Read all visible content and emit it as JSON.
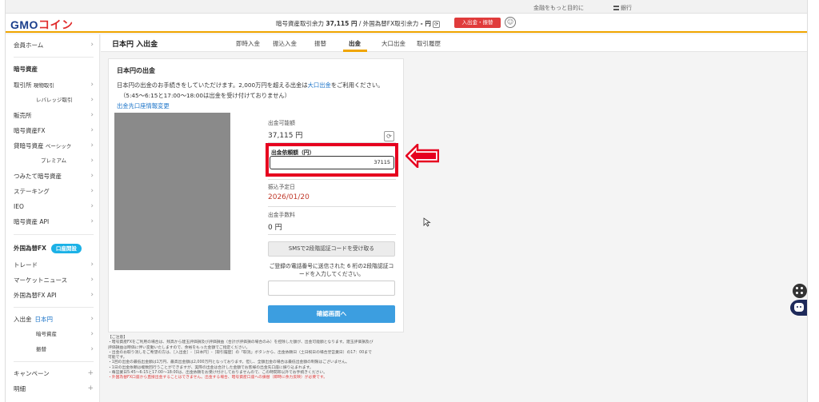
{
  "utility": {
    "more_convenient": "金融をもっと目的に",
    "bank": "銀行"
  },
  "header": {
    "logo_main": "GMO",
    "logo_sub": "コイン",
    "crypto_available_label": "暗号資産取引余力",
    "crypto_available_value": "37,115 円",
    "separator": "/",
    "fx_available_label": "外国為替FX取引余力",
    "fx_available_value": "- 円",
    "deposit_button": "入出金・振替"
  },
  "sidebar": {
    "home": "会員ホーム",
    "crypto_heading": "暗号資産",
    "exchange": "取引所",
    "exchange_sub": "現物取引",
    "leverage": "レバレッジ取引",
    "dealer": "販売所",
    "crypto_fx": "暗号資産FX",
    "lending": "貸暗号資産",
    "lending_sub": "ベーシック",
    "premium": "プレミアム",
    "tsumitate": "つみたて暗号資産",
    "staking": "ステーキング",
    "ieo": "IEO",
    "crypto_api": "暗号資産 API",
    "fx_heading": "外国為替FX",
    "fx_badge": "口座開設",
    "trade": "トレード",
    "market_news": "マーケットニュース",
    "fx_api": "外国為替FX API",
    "deposit_withdraw": "入出金",
    "jpy": "日本円",
    "crypto_assets": "暗号資産",
    "transfer": "振替",
    "campaign": "キャンペーン",
    "details": "明細",
    "chev": "›",
    "plus": "+"
  },
  "tabs": {
    "page_title": "日本円 入出金",
    "items": [
      "即時入金",
      "振込入金",
      "振替",
      "出金",
      "大口出金",
      "取引履歴"
    ]
  },
  "card": {
    "title": "日本円の出金",
    "intro_part1": "日本円の出金のお手続きをしていただけます。2,000万円を超える出金は",
    "intro_link": "大口出金",
    "intro_part2": "をご利用ください。",
    "intro_hours": "（5:45〜6:15と17:00〜18:00は出金を受け付けておりません）",
    "bank_change_link": "出金先口座情報変更"
  },
  "form": {
    "available_label": "出金可能額",
    "available_value": "37,115 円",
    "amount_label": "出金依頼額（円）",
    "amount_value": "37115",
    "transfer_date_label": "振込予定日",
    "transfer_date_value": "2026/01/20",
    "fee_label": "出金手数料",
    "fee_value": "0 円",
    "sms_button": "SMSで2段階認証コードを受け取る",
    "sms_note": "ご登録の電話番号に送信された 6 桁の2段階認証コードを入力してください。",
    "confirm_button": "確認画面へ"
  },
  "notes": {
    "heading": "【ご注意】",
    "lines": [
      "・暗号資産FXをご利用の場合は、残高から建玉評価損及び評価損益（合計が評価損の場合のみ）を控除した額が、出金可能額となります。建玉評価損及び",
      "評価損益は時価に伴い変動いたしますので、余裕をもった金額でご指定ください。",
      "・出金のお取り消しをご希望の方は、［入出金］-［日本円］-［取引履歴］の「取消」ボタンから、出金依頼日（土日祝日の場合翌営業日）の17：00まで",
      "可能です。",
      "・1回の出金の最低出金額は1万円、最高出金額は2,000万円となっております。但し、全額出金の場合は最低出金額の制限はございません。",
      "・1日の出金依頼は複数回行うことができますが、実際の出金は合計した金額でお客様の出金先口座に振り込まれます。",
      "・毎営業日5:45〜6:15と17:00〜18:00は、出金依頼をお受け付けしておりませんので、この時間帯以外でお手続きください。"
    ],
    "red_line": "・外国為替FX口座から直接出金することはできません。出金する場合、暗号資産口座への振替（即時に余力反映）が必要です。"
  },
  "colors": {
    "accent": "#f0a500",
    "brand": "#1a3e8c",
    "highlight": "#e6001f",
    "primary_button": "#3c9ee0"
  }
}
